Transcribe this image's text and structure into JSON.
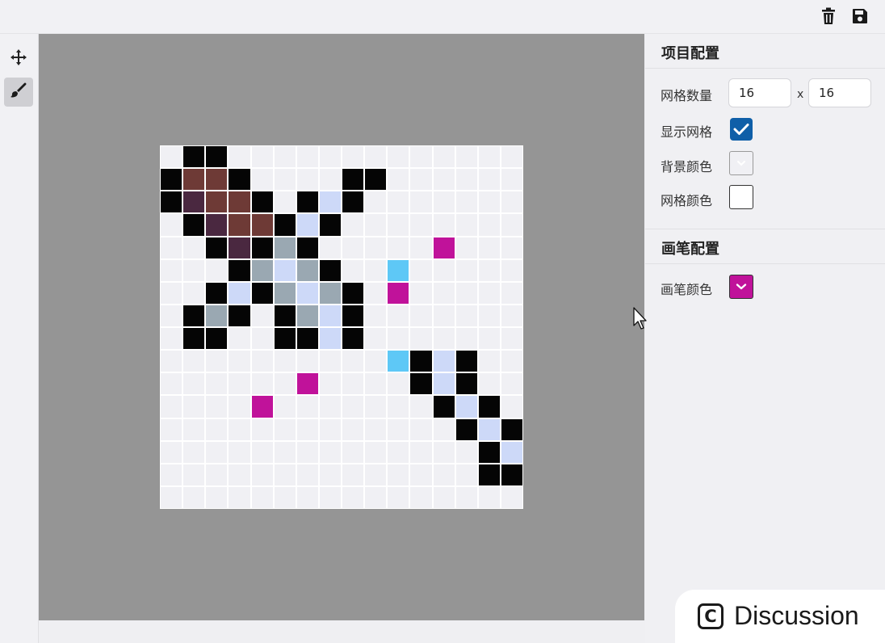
{
  "topbar": {
    "delete_icon": "trash-icon",
    "save_icon": "save-icon"
  },
  "toolbar": {
    "tools": [
      {
        "icon": "move-icon",
        "active": false
      },
      {
        "icon": "brush-icon",
        "active": true
      }
    ]
  },
  "panel": {
    "project_title": "项目配置",
    "grid_count_label": "网格数量",
    "grid_cols": "16",
    "times_sign": "x",
    "grid_rows": "16",
    "show_grid_label": "显示网格",
    "show_grid": true,
    "background_color_label": "背景颜色",
    "background_color": "#f0f0f4",
    "grid_color_label": "网格颜色",
    "grid_color": "#ffffff",
    "brush_title": "画笔配置",
    "brush_color_label": "画笔颜色",
    "brush_color": "#c0129a"
  },
  "canvas": {
    "size": 16,
    "palette": {
      ".": "#f0f0f4",
      "K": "#050505",
      "R": "#6e3a36",
      "P": "#4a2840",
      "L": "#cdd9f8",
      "G": "#9aa8b2",
      "M": "#c0129a",
      "C": "#5ec8f6"
    },
    "rows": [
      ".KK.............",
      "KRRK....KK......",
      "KPRRK.KLK.......",
      ".KPRRKLK........",
      "..KPKGK.....M...",
      "...KGLGK..C.....",
      "..KLKGLGK.M.....",
      ".KGK.KGLK.......",
      ".KK..KKLK.......",
      "..........CKLK......",
      "......M....KLK..",
      "....M.......KLK.",
      ".............KLK",
      "..............KL",
      "..............KK",
      "................"
    ]
  },
  "discussion": {
    "label": "Discussion",
    "icon": "discussion-logo-icon"
  }
}
